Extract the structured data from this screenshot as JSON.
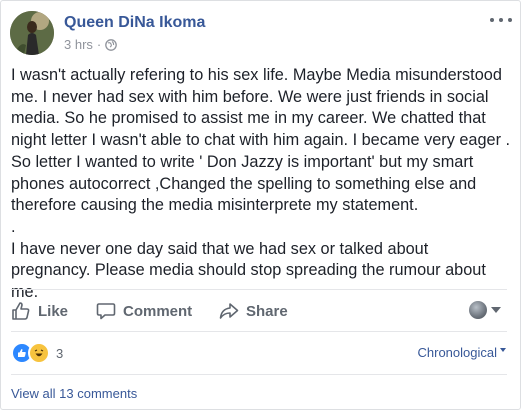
{
  "post": {
    "author": "Queen DiNa Ikoma",
    "time": "3 hrs",
    "privacy_separator": "·",
    "privacy_icon": "globe-icon",
    "body_paragraphs": [
      "I wasn't actually refering to his sex life. Maybe Media misunderstood me. I never had sex with him before. We were just friends in social media. So he promised to assist me in my career. We chatted that night letter I wasn't able to chat with him again. I became very eager . So letter I wanted to write ' Don Jazzy is important' but my smart phones autocorrect ,Changed the spelling to something else and therefore causing the media misinterprete my statement.",
      ".",
      "I have never one day said that we had sex or talked about pregnancy. Please media should stop spreading the rumour about me."
    ]
  },
  "actions": {
    "like": "Like",
    "comment": "Comment",
    "share": "Share"
  },
  "reactions": {
    "types": [
      "like",
      "haha"
    ],
    "count": "3"
  },
  "comments": {
    "order_label": "Chronological",
    "view_all": "View all 13 comments"
  },
  "colors": {
    "link_blue": "#385898",
    "text": "#1d2129",
    "muted": "#90949c",
    "action_gray": "#606770"
  }
}
